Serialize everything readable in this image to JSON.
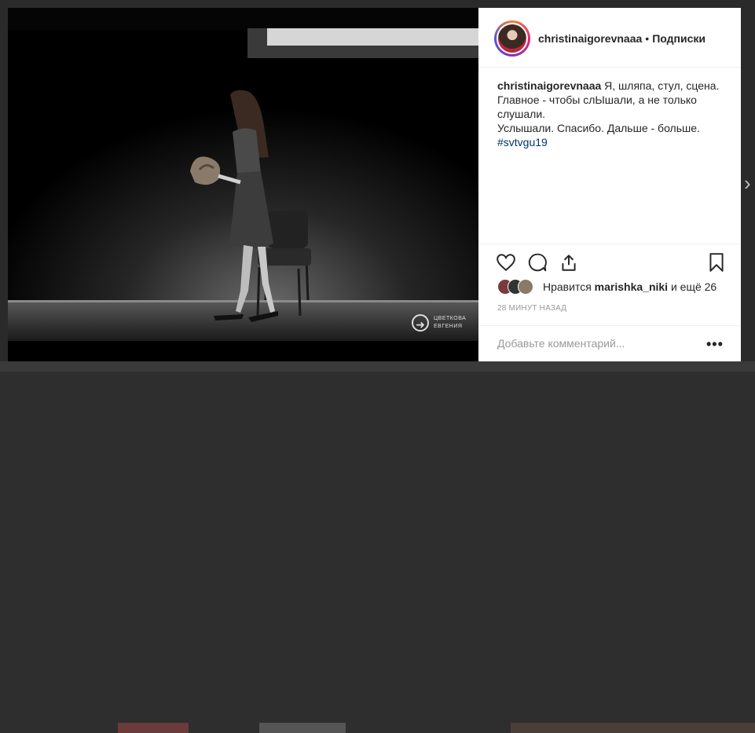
{
  "post": {
    "username": "christinaigorevnaaa",
    "separator": "•",
    "follow_status": "Подписки",
    "caption_username": "christinaigorevnaaa",
    "caption_line1": "Я, шляпа, стул, сцена.",
    "caption_line2": "Главное - чтобы слЫшали, а не только слушали.",
    "caption_line3": "Услышали. Спасибо. Дальше - больше.",
    "hashtag": "#svtvgu19",
    "likes_prefix": "Нравится ",
    "likes_user": "marishka_niki",
    "likes_suffix": " и ещё 26",
    "timestamp": "28 МИНУТ НАЗАД",
    "comment_placeholder": "Добавьте комментарий...",
    "more_options": "•••"
  },
  "photo": {
    "watermark_line1": "ЦВЕТКОВА",
    "watermark_line2": "ЕВГЕНИЯ"
  },
  "icons": {
    "like": "heart-icon",
    "comment": "comment-icon",
    "share": "share-icon",
    "save": "bookmark-icon",
    "next": "chevron-right-icon"
  },
  "colors": {
    "hashtag": "#003569",
    "text": "#262626",
    "muted": "#999999"
  }
}
